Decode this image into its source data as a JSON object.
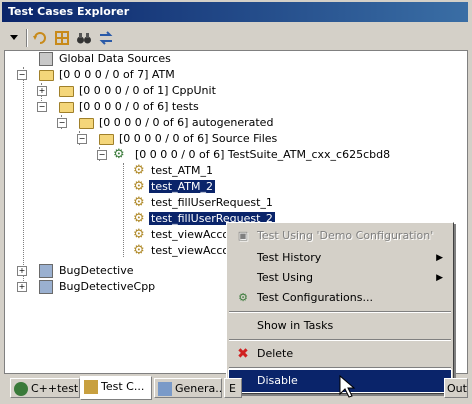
{
  "window": {
    "title": "Test Cases Explorer"
  },
  "tree": {
    "global_data_sources": "Global Data Sources",
    "atm": "[0 0 0 0 / 0 of 7] ATM",
    "cppunit": "[0 0 0 0 / 0 of 1] CppUnit",
    "tests": "[0 0 0 0 / 0 of 6] tests",
    "autogenerated": "[0 0 0 0 / 0 of 6] autogenerated",
    "source_files": "[0 0 0 0 / 0 of 6] Source Files",
    "testsuite": "[0 0 0 0 / 0 of 6] TestSuite_ATM_cxx_c625cbd8",
    "tests_list": [
      "test_ATM_1",
      "test_ATM_2",
      "test_fillUserRequest_1",
      "test_fillUserRequest_2",
      "test_viewAccou",
      "test_viewAccou"
    ],
    "bugdetective": "BugDetective",
    "bugdetectivecpp": "BugDetectiveCpp"
  },
  "context_menu": {
    "test_using_demo": "Test Using 'Demo Configuration'",
    "test_history": "Test History",
    "test_using": "Test Using",
    "test_configurations": "Test Configurations...",
    "show_in_tasks": "Show in Tasks",
    "delete": "Delete",
    "disable": "Disable"
  },
  "tabs": {
    "cpptest": "C++test",
    "test_cases": "Test C...",
    "general": "Genera...",
    "more_1": "E",
    "more_2": "Outp"
  },
  "colors": {
    "selection": "#0a246a",
    "titlebar": "#0a246a",
    "face": "#d4d0c8"
  }
}
